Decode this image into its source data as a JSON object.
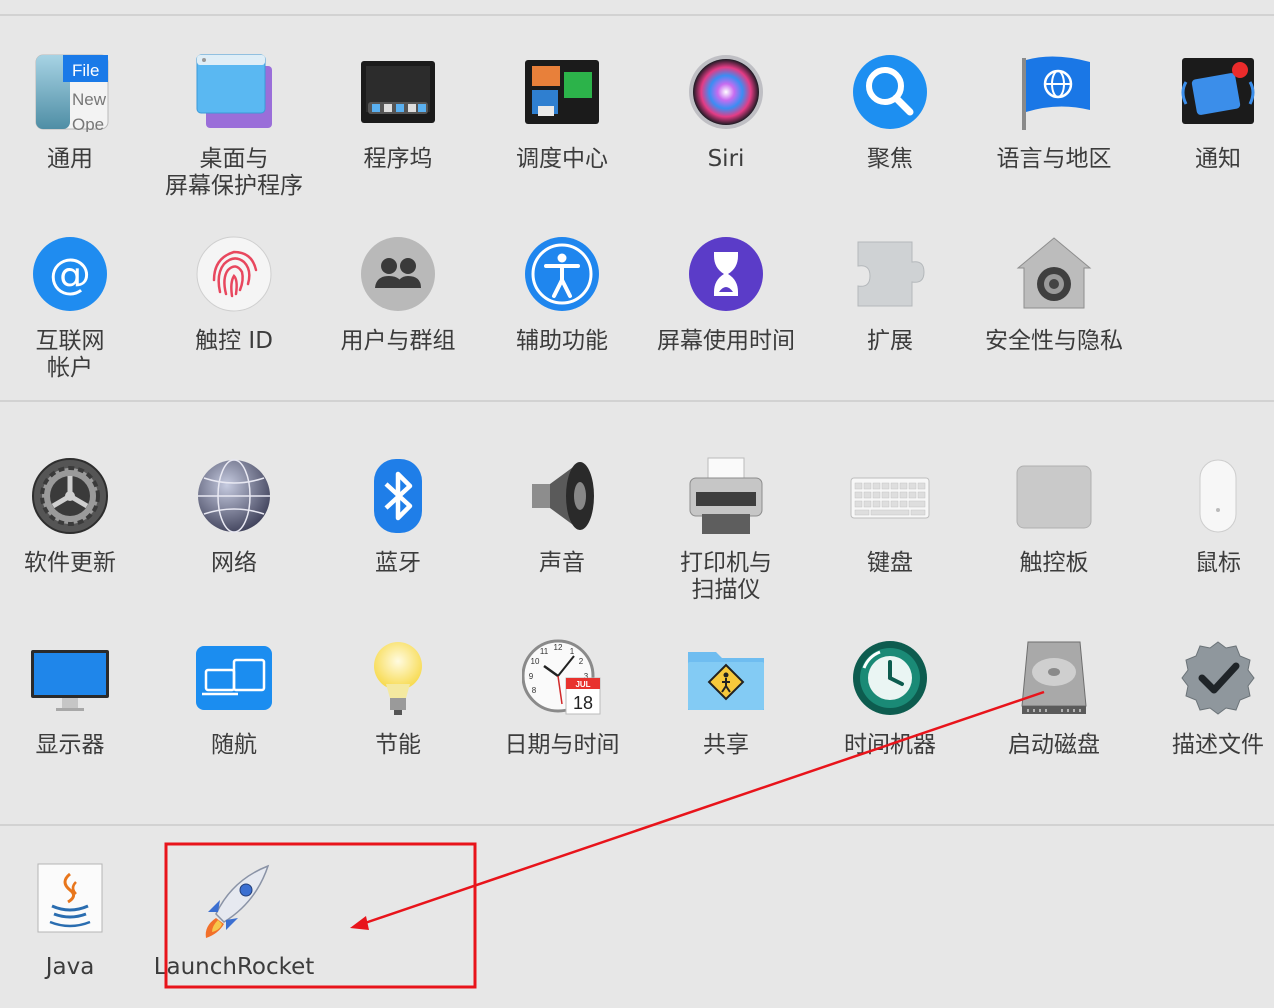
{
  "colors": {
    "background": "#e7e7e7",
    "label": "#3c3c3c",
    "annotation": "#e8141b",
    "divider": "#d2d2d2"
  },
  "sections": [
    {
      "name": "personal",
      "rows": [
        [
          {
            "id": "general",
            "label": "通用",
            "icon": "general-icon",
            "file_label": "File",
            "new_label": "New",
            "open_label": "Ope"
          },
          {
            "id": "desktop",
            "label": "桌面与\n屏幕保护程序",
            "icon": "desktop-screensaver-icon"
          },
          {
            "id": "dock",
            "label": "程序坞",
            "icon": "dock-icon"
          },
          {
            "id": "mission",
            "label": "调度中心",
            "icon": "mission-control-icon"
          },
          {
            "id": "siri",
            "label": "Siri",
            "icon": "siri-icon"
          },
          {
            "id": "spotlight",
            "label": "聚焦",
            "icon": "spotlight-icon"
          },
          {
            "id": "language",
            "label": "语言与地区",
            "icon": "language-region-icon"
          },
          {
            "id": "notifications",
            "label": "通知",
            "icon": "notifications-icon"
          }
        ],
        [
          {
            "id": "internet",
            "label": "互联网\n帐户",
            "icon": "internet-accounts-icon"
          },
          {
            "id": "touchid",
            "label": "触控 ID",
            "icon": "touch-id-icon"
          },
          {
            "id": "users",
            "label": "用户与群组",
            "icon": "users-groups-icon"
          },
          {
            "id": "accessibility",
            "label": "辅助功能",
            "icon": "accessibility-icon"
          },
          {
            "id": "screentime",
            "label": "屏幕使用时间",
            "icon": "screen-time-icon"
          },
          {
            "id": "extensions",
            "label": "扩展",
            "icon": "extensions-icon"
          },
          {
            "id": "security",
            "label": "安全性与隐私",
            "icon": "security-privacy-icon"
          }
        ]
      ]
    },
    {
      "name": "hardware",
      "rows": [
        [
          {
            "id": "update",
            "label": "软件更新",
            "icon": "software-update-icon"
          },
          {
            "id": "network",
            "label": "网络",
            "icon": "network-icon"
          },
          {
            "id": "bluetooth",
            "label": "蓝牙",
            "icon": "bluetooth-icon"
          },
          {
            "id": "sound",
            "label": "声音",
            "icon": "sound-icon"
          },
          {
            "id": "printers",
            "label": "打印机与\n扫描仪",
            "icon": "printers-scanners-icon"
          },
          {
            "id": "keyboard",
            "label": "键盘",
            "icon": "keyboard-icon"
          },
          {
            "id": "trackpad",
            "label": "触控板",
            "icon": "trackpad-icon"
          },
          {
            "id": "mouse",
            "label": "鼠标",
            "icon": "mouse-icon"
          }
        ],
        [
          {
            "id": "displays",
            "label": "显示器",
            "icon": "displays-icon"
          },
          {
            "id": "sidecar",
            "label": "随航",
            "icon": "sidecar-icon"
          },
          {
            "id": "energy",
            "label": "节能",
            "icon": "energy-saver-icon"
          },
          {
            "id": "datetime",
            "label": "日期与时间",
            "icon": "date-time-icon",
            "month": "JUL",
            "day": "18",
            "clock_12": "12",
            "clock_1": "1",
            "clock_2": "2",
            "clock_3": "3",
            "clock_8": "8",
            "clock_9": "9",
            "clock_10": "10",
            "clock_11": "11"
          },
          {
            "id": "sharing",
            "label": "共享",
            "icon": "sharing-icon"
          },
          {
            "id": "timemachine",
            "label": "时间机器",
            "icon": "time-machine-icon"
          },
          {
            "id": "startup",
            "label": "启动磁盘",
            "icon": "startup-disk-icon"
          },
          {
            "id": "profiles",
            "label": "描述文件",
            "icon": "profiles-icon"
          }
        ]
      ]
    },
    {
      "name": "other",
      "rows": [
        [
          {
            "id": "java",
            "label": "Java",
            "icon": "java-icon"
          },
          {
            "id": "launchrocket",
            "label": "LaunchRocket",
            "icon": "launchrocket-icon"
          }
        ]
      ]
    }
  ]
}
